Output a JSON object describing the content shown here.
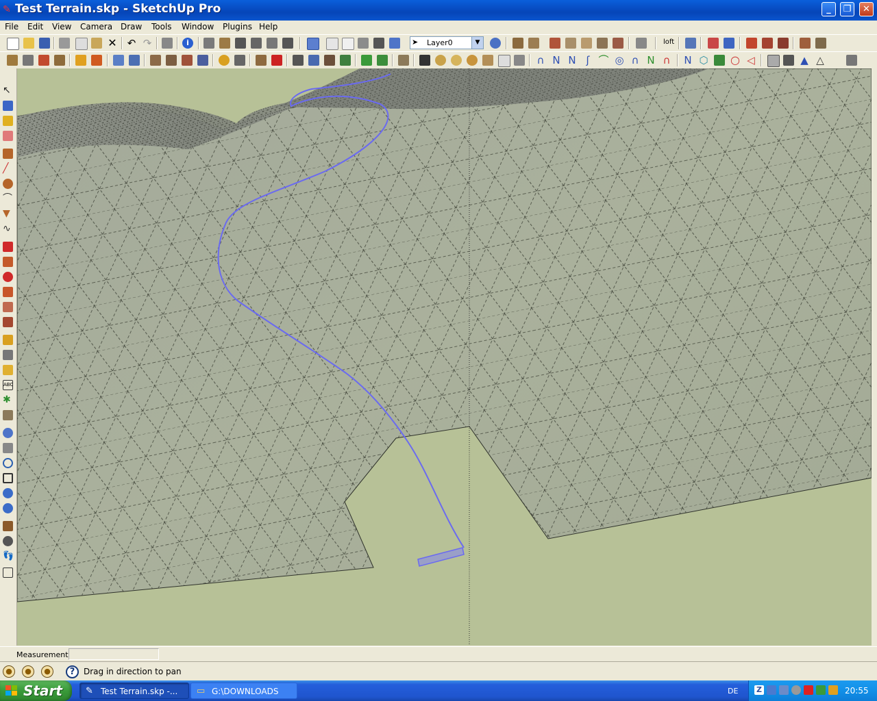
{
  "window": {
    "title": "Test Terrain.skp - SketchUp Pro"
  },
  "menu": [
    "File",
    "Edit",
    "View",
    "Camera",
    "Draw",
    "Tools",
    "Window",
    "Plugins",
    "Help"
  ],
  "toolbar": {
    "layer_select": "Layer0",
    "loft_label": "loft"
  },
  "measurements": {
    "label": "Measurements",
    "value": ""
  },
  "status": {
    "hint": "Drag in direction to pan"
  },
  "taskbar": {
    "start": "Start",
    "tasks": [
      "Test Terrain.skp -...",
      "G:\\DOWNLOADS"
    ],
    "lang": "DE",
    "clock": "20:55"
  },
  "colors": {
    "background": "#B7C197",
    "terrain": "#A7AE97",
    "path": "#6A6AF0",
    "titlebar": "#0A5FDB"
  },
  "icons": {
    "left_tools": [
      "select-icon",
      "component-icon",
      "paint-bucket-icon",
      "eraser-icon",
      "rectangle-icon",
      "line-icon",
      "circle-icon",
      "arc-icon",
      "polygon-icon",
      "freehand-icon",
      "move-icon",
      "push-pull-icon",
      "rotate-icon",
      "follow-me-icon",
      "scale-icon",
      "offset-icon",
      "tape-measure-icon",
      "dimension-icon",
      "protractor-icon",
      "text-icon",
      "axes-icon",
      "3d-text-icon",
      "orbit-icon",
      "pan-icon",
      "zoom-icon",
      "zoom-window-icon",
      "zoom-extents-icon",
      "previous-icon",
      "position-camera-icon",
      "look-around-icon",
      "walk-icon",
      "section-plane-icon"
    ]
  }
}
